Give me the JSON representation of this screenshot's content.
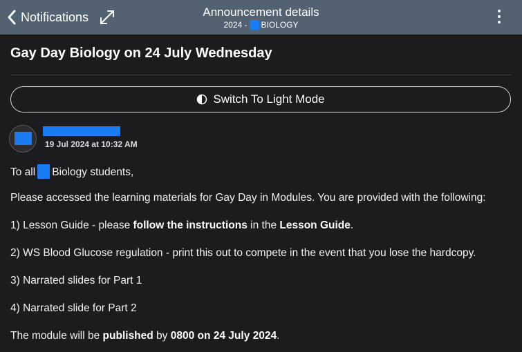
{
  "header": {
    "back_label": "Notifications",
    "title": "Announcement details",
    "subtitle_prefix": "2024 -",
    "subtitle_suffix": "BIOLOGY"
  },
  "announcement": {
    "title": "Gay Day Biology on 24 July Wednesday",
    "switch_label": "Switch To Light Mode",
    "date": "19 Jul 2024 at 10:32 AM",
    "greeting_pre": "To all",
    "greeting_post": "Biology students,",
    "intro": "Please accessed the learning materials for Gay Day in Modules. You are provided with the following:",
    "item1": {
      "p1": "1) Lesson Guide - please ",
      "b1": "follow the instructions",
      "p2": " in the ",
      "b2": "Lesson Guide",
      "p3": "."
    },
    "item2": "2) WS Blood Glucose regulation - print this out to compete in the event that you lose the hardcopy.",
    "item3": "3) Narrated slides for Part 1",
    "item4": "4) Narrated slide for Part 2",
    "closing": {
      "p1": "The module will be ",
      "b1": "published",
      "p2": " by ",
      "b2": "0800 on 24 July 2024",
      "p3": "."
    }
  },
  "colors": {
    "header_bg": "#536270",
    "page_bg": "#1c1c1e",
    "redaction": "#1a7cf5"
  },
  "icons": [
    "chevron-left-icon",
    "expand-icon",
    "more-vertical-icon",
    "contrast-icon"
  ]
}
